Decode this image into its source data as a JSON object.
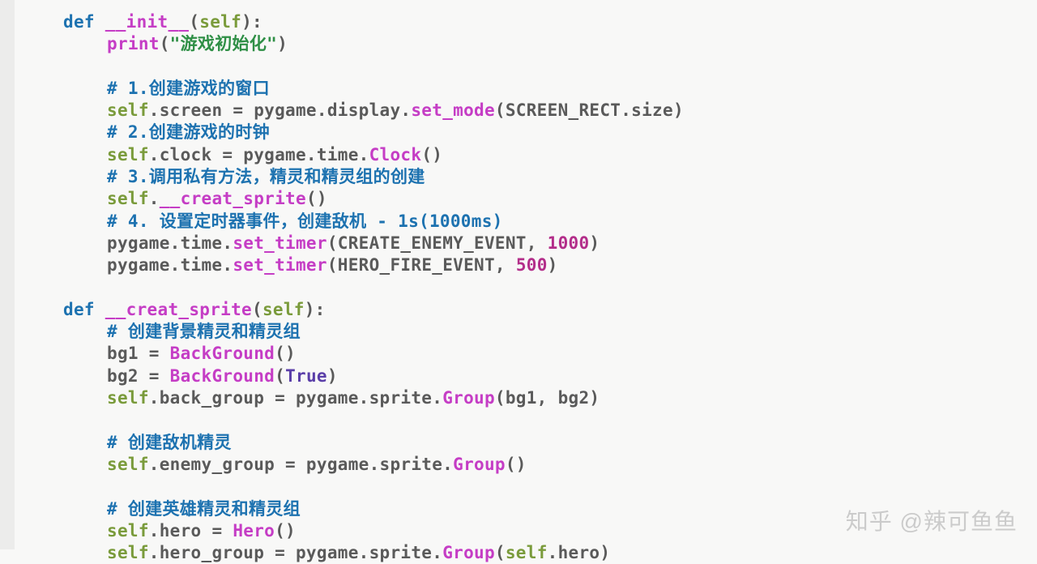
{
  "code": {
    "lines": [
      {
        "indent": 1,
        "tokens": [
          {
            "cls": "kw",
            "t": "def "
          },
          {
            "cls": "fn",
            "t": "__init__"
          },
          {
            "cls": "punc",
            "t": "("
          },
          {
            "cls": "self",
            "t": "self"
          },
          {
            "cls": "punc",
            "t": "):"
          }
        ]
      },
      {
        "indent": 2,
        "tokens": [
          {
            "cls": "fn",
            "t": "print"
          },
          {
            "cls": "punc",
            "t": "("
          },
          {
            "cls": "str",
            "t": "\"游戏初始化\""
          },
          {
            "cls": "punc",
            "t": ")"
          }
        ]
      },
      {
        "indent": 2,
        "tokens": []
      },
      {
        "indent": 2,
        "tokens": [
          {
            "cls": "cmt",
            "t": "# 1.创建游戏的窗口"
          }
        ]
      },
      {
        "indent": 2,
        "tokens": [
          {
            "cls": "self",
            "t": "self"
          },
          {
            "cls": "punc",
            "t": ".screen = pygame.display."
          },
          {
            "cls": "fn",
            "t": "set_mode"
          },
          {
            "cls": "punc",
            "t": "(SCREEN_RECT.size)"
          }
        ]
      },
      {
        "indent": 2,
        "tokens": [
          {
            "cls": "cmt",
            "t": "# 2.创建游戏的时钟"
          }
        ]
      },
      {
        "indent": 2,
        "tokens": [
          {
            "cls": "self",
            "t": "self"
          },
          {
            "cls": "punc",
            "t": ".clock = pygame.time."
          },
          {
            "cls": "fn",
            "t": "Clock"
          },
          {
            "cls": "punc",
            "t": "()"
          }
        ]
      },
      {
        "indent": 2,
        "tokens": [
          {
            "cls": "cmt",
            "t": "# 3.调用私有方法，精灵和精灵组的创建"
          }
        ]
      },
      {
        "indent": 2,
        "tokens": [
          {
            "cls": "self",
            "t": "self"
          },
          {
            "cls": "punc",
            "t": "."
          },
          {
            "cls": "fn",
            "t": "__creat_sprite"
          },
          {
            "cls": "punc",
            "t": "()"
          }
        ]
      },
      {
        "indent": 2,
        "tokens": [
          {
            "cls": "cmt",
            "t": "# 4. 设置定时器事件，创建敌机 - 1s(1000ms)"
          }
        ]
      },
      {
        "indent": 2,
        "tokens": [
          {
            "cls": "punc",
            "t": "pygame.time."
          },
          {
            "cls": "fn",
            "t": "set_timer"
          },
          {
            "cls": "punc",
            "t": "(CREATE_ENEMY_EVENT, "
          },
          {
            "cls": "num",
            "t": "1000"
          },
          {
            "cls": "punc",
            "t": ")"
          }
        ]
      },
      {
        "indent": 2,
        "tokens": [
          {
            "cls": "punc",
            "t": "pygame.time."
          },
          {
            "cls": "fn",
            "t": "set_timer"
          },
          {
            "cls": "punc",
            "t": "(HERO_FIRE_EVENT, "
          },
          {
            "cls": "num",
            "t": "500"
          },
          {
            "cls": "punc",
            "t": ")"
          }
        ]
      },
      {
        "indent": 1,
        "tokens": []
      },
      {
        "indent": 1,
        "tokens": [
          {
            "cls": "kw",
            "t": "def "
          },
          {
            "cls": "fn",
            "t": "__creat_sprite"
          },
          {
            "cls": "punc",
            "t": "("
          },
          {
            "cls": "self",
            "t": "self"
          },
          {
            "cls": "punc",
            "t": "):"
          }
        ]
      },
      {
        "indent": 2,
        "tokens": [
          {
            "cls": "cmt",
            "t": "# 创建背景精灵和精灵组"
          }
        ]
      },
      {
        "indent": 2,
        "tokens": [
          {
            "cls": "punc",
            "t": "bg1 = "
          },
          {
            "cls": "fn",
            "t": "BackGround"
          },
          {
            "cls": "punc",
            "t": "()"
          }
        ]
      },
      {
        "indent": 2,
        "tokens": [
          {
            "cls": "punc",
            "t": "bg2 = "
          },
          {
            "cls": "fn",
            "t": "BackGround"
          },
          {
            "cls": "punc",
            "t": "("
          },
          {
            "cls": "bool",
            "t": "True"
          },
          {
            "cls": "punc",
            "t": ")"
          }
        ]
      },
      {
        "indent": 2,
        "tokens": [
          {
            "cls": "self",
            "t": "self"
          },
          {
            "cls": "punc",
            "t": ".back_group = pygame.sprite."
          },
          {
            "cls": "fn",
            "t": "Group"
          },
          {
            "cls": "punc",
            "t": "(bg1, bg2)"
          }
        ]
      },
      {
        "indent": 2,
        "tokens": []
      },
      {
        "indent": 2,
        "tokens": [
          {
            "cls": "cmt",
            "t": "# 创建敌机精灵"
          }
        ]
      },
      {
        "indent": 2,
        "tokens": [
          {
            "cls": "self",
            "t": "self"
          },
          {
            "cls": "punc",
            "t": ".enemy_group = pygame.sprite."
          },
          {
            "cls": "fn",
            "t": "Group"
          },
          {
            "cls": "punc",
            "t": "()"
          }
        ]
      },
      {
        "indent": 2,
        "tokens": []
      },
      {
        "indent": 2,
        "tokens": [
          {
            "cls": "cmt",
            "t": "# 创建英雄精灵和精灵组"
          }
        ]
      },
      {
        "indent": 2,
        "tokens": [
          {
            "cls": "self",
            "t": "self"
          },
          {
            "cls": "punc",
            "t": ".hero = "
          },
          {
            "cls": "fn",
            "t": "Hero"
          },
          {
            "cls": "punc",
            "t": "()"
          }
        ]
      },
      {
        "indent": 2,
        "tokens": [
          {
            "cls": "self",
            "t": "self"
          },
          {
            "cls": "punc",
            "t": ".hero_group = pygame.sprite."
          },
          {
            "cls": "fn",
            "t": "Group"
          },
          {
            "cls": "punc",
            "t": "("
          },
          {
            "cls": "self",
            "t": "self"
          },
          {
            "cls": "punc",
            "t": ".hero)"
          }
        ]
      }
    ]
  },
  "watermark": "知乎 @辣可鱼鱼"
}
